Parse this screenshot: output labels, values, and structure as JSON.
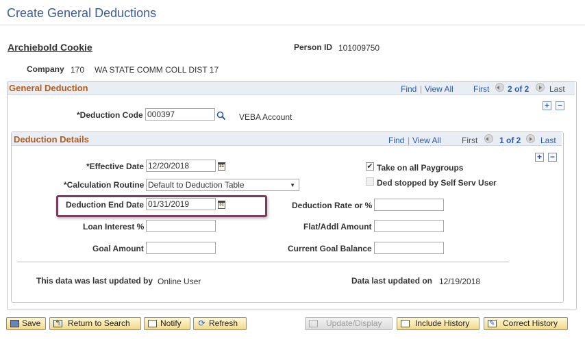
{
  "page": {
    "title": "Create General Deductions"
  },
  "person": {
    "name": "Archiebold Cookie",
    "person_id_label": "Person ID",
    "person_id": "101009750",
    "company_label": "Company",
    "company_code": "170",
    "company_name": "WA STATE COMM COLL DIST 17"
  },
  "general_deduction": {
    "title": "General Deduction",
    "nav": {
      "find": "Find",
      "sep": "|",
      "view_all": "View All",
      "first": "First",
      "position": "2 of 2",
      "last": "Last"
    },
    "deduction_code_label": "*Deduction Code",
    "deduction_code": "000397",
    "deduction_desc": "VEBA Account"
  },
  "deduction_details": {
    "title": "Deduction Details",
    "nav": {
      "find": "Find",
      "sep": "|",
      "view_all": "View All",
      "first": "First",
      "position": "1 of 2",
      "last": "Last"
    },
    "effective_date_label": "*Effective Date",
    "effective_date": "12/20/2018",
    "calc_routine_label": "*Calculation Routine",
    "calc_routine": "Default to Deduction Table",
    "end_date_label": "Deduction End Date",
    "end_date": "01/31/2019",
    "loan_interest_label": "Loan Interest %",
    "loan_interest": "",
    "goal_amount_label": "Goal Amount",
    "goal_amount": "",
    "take_on_all_label": "Take on all Paygroups",
    "take_on_all_checked": true,
    "ded_stopped_label": "Ded stopped by Self Serv User",
    "ded_stopped_checked": false,
    "rate_label": "Deduction Rate or %",
    "rate": "",
    "flat_label": "Flat/Addl Amount",
    "flat": "",
    "goal_balance_label": "Current Goal Balance",
    "goal_balance": "",
    "updated_by_label": "This data was last updated by",
    "updated_by": "Online User",
    "updated_on_label": "Data last updated on",
    "updated_on": "12/19/2018"
  },
  "icons": {
    "add": "+",
    "delete": "−",
    "calendar": "31",
    "search": "search-icon",
    "dropdown": "▼",
    "check": "✔"
  },
  "toolbar": {
    "save": "Save",
    "return_to_search": "Return to Search",
    "notify": "Notify",
    "refresh": "Refresh",
    "update_display": "Update/Display",
    "include_history": "Include History",
    "correct_history": "Correct History"
  }
}
